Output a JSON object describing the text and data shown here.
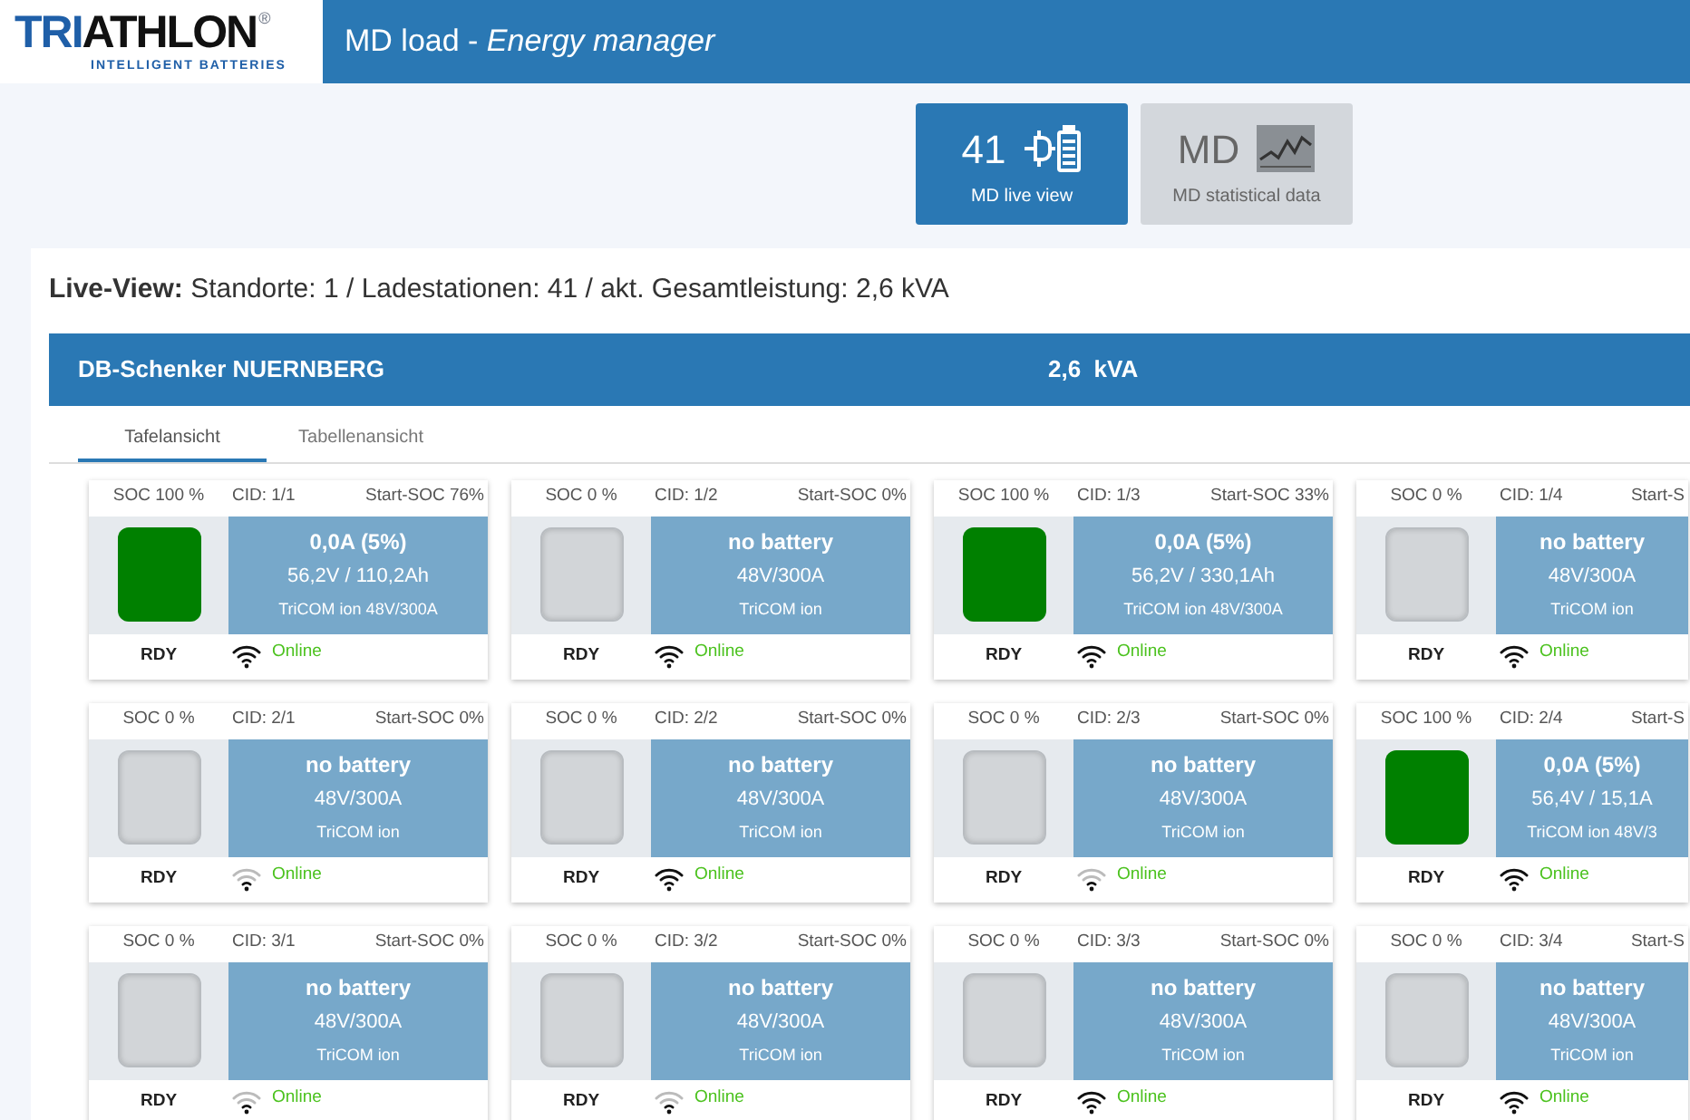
{
  "logo": {
    "wordmark": "TRIATHLON",
    "registered": "®",
    "tagline": "INTELLIGENT BATTERIES"
  },
  "title": "MD load - *Energy manager*",
  "tiles": [
    {
      "value": "41",
      "label": "MD live view",
      "selected": true
    },
    {
      "value": "MD",
      "label": "MD statistical data",
      "selected": false
    }
  ],
  "summary": "**Live-View:** Standorte: 1 / Ladestationen: 41 / akt. Gesamtleistung: 2,6 kVA",
  "site": {
    "name": "DB-Schenker NUERNBERG",
    "power": "2,6  kVA"
  },
  "tabs": [
    {
      "label": "Tafelansicht",
      "selected": true
    },
    {
      "label": "Tabellenansicht",
      "selected": false
    }
  ],
  "stations": [
    {
      "soc": "SOC 100 %",
      "cid": "CID: 1/1",
      "start_soc": "Start-SOC 76%",
      "charged": true,
      "lines": [
        "0,0A (5%)",
        "56,2V / 110,2Ah",
        "TriCOM ion 48V/300A"
      ],
      "state": "RDY",
      "weak_signal": false,
      "online": "Online"
    },
    {
      "soc": "SOC 0 %",
      "cid": "CID: 1/2",
      "start_soc": "Start-SOC 0%",
      "charged": false,
      "lines": [
        "no battery",
        "48V/300A",
        "TriCOM ion"
      ],
      "state": "RDY",
      "weak_signal": false,
      "online": "Online"
    },
    {
      "soc": "SOC 100 %",
      "cid": "CID: 1/3",
      "start_soc": "Start-SOC 33%",
      "charged": true,
      "lines": [
        "0,0A (5%)",
        "56,2V / 330,1Ah",
        "TriCOM ion 48V/300A"
      ],
      "state": "RDY",
      "weak_signal": false,
      "online": "Online"
    },
    {
      "soc": "SOC 0 %",
      "cid": "CID: 1/4",
      "start_soc": "Start-S",
      "charged": false,
      "lines": [
        "no battery",
        "48V/300A",
        "TriCOM ion"
      ],
      "state": "RDY",
      "weak_signal": false,
      "online": "Online"
    },
    {
      "soc": "SOC 0 %",
      "cid": "CID: 2/1",
      "start_soc": "Start-SOC 0%",
      "charged": false,
      "lines": [
        "no battery",
        "48V/300A",
        "TriCOM ion"
      ],
      "state": "RDY",
      "weak_signal": true,
      "online": "Online"
    },
    {
      "soc": "SOC 0 %",
      "cid": "CID: 2/2",
      "start_soc": "Start-SOC 0%",
      "charged": false,
      "lines": [
        "no battery",
        "48V/300A",
        "TriCOM ion"
      ],
      "state": "RDY",
      "weak_signal": false,
      "online": "Online"
    },
    {
      "soc": "SOC 0 %",
      "cid": "CID: 2/3",
      "start_soc": "Start-SOC 0%",
      "charged": false,
      "lines": [
        "no battery",
        "48V/300A",
        "TriCOM ion"
      ],
      "state": "RDY",
      "weak_signal": true,
      "online": "Online"
    },
    {
      "soc": "SOC 100 %",
      "cid": "CID: 2/4",
      "start_soc": "Start-S",
      "charged": true,
      "lines": [
        "0,0A (5%)",
        "56,4V / 15,1A",
        "TriCOM ion 48V/3"
      ],
      "state": "RDY",
      "weak_signal": false,
      "online": "Online"
    },
    {
      "soc": "SOC 0 %",
      "cid": "CID: 3/1",
      "start_soc": "Start-SOC 0%",
      "charged": false,
      "lines": [
        "no battery",
        "48V/300A",
        "TriCOM ion"
      ],
      "state": "RDY",
      "weak_signal": true,
      "online": "Online"
    },
    {
      "soc": "SOC 0 %",
      "cid": "CID: 3/2",
      "start_soc": "Start-SOC 0%",
      "charged": false,
      "lines": [
        "no battery",
        "48V/300A",
        "TriCOM ion"
      ],
      "state": "RDY",
      "weak_signal": true,
      "online": "Online"
    },
    {
      "soc": "SOC 0 %",
      "cid": "CID: 3/3",
      "start_soc": "Start-SOC 0%",
      "charged": false,
      "lines": [
        "no battery",
        "48V/300A",
        "TriCOM ion"
      ],
      "state": "RDY",
      "weak_signal": false,
      "online": "Online"
    },
    {
      "soc": "SOC 0 %",
      "cid": "CID: 3/4",
      "start_soc": "Start-S",
      "charged": false,
      "lines": [
        "no battery",
        "48V/300A",
        "TriCOM ion"
      ],
      "state": "RDY",
      "weak_signal": false,
      "online": "Online"
    }
  ]
}
